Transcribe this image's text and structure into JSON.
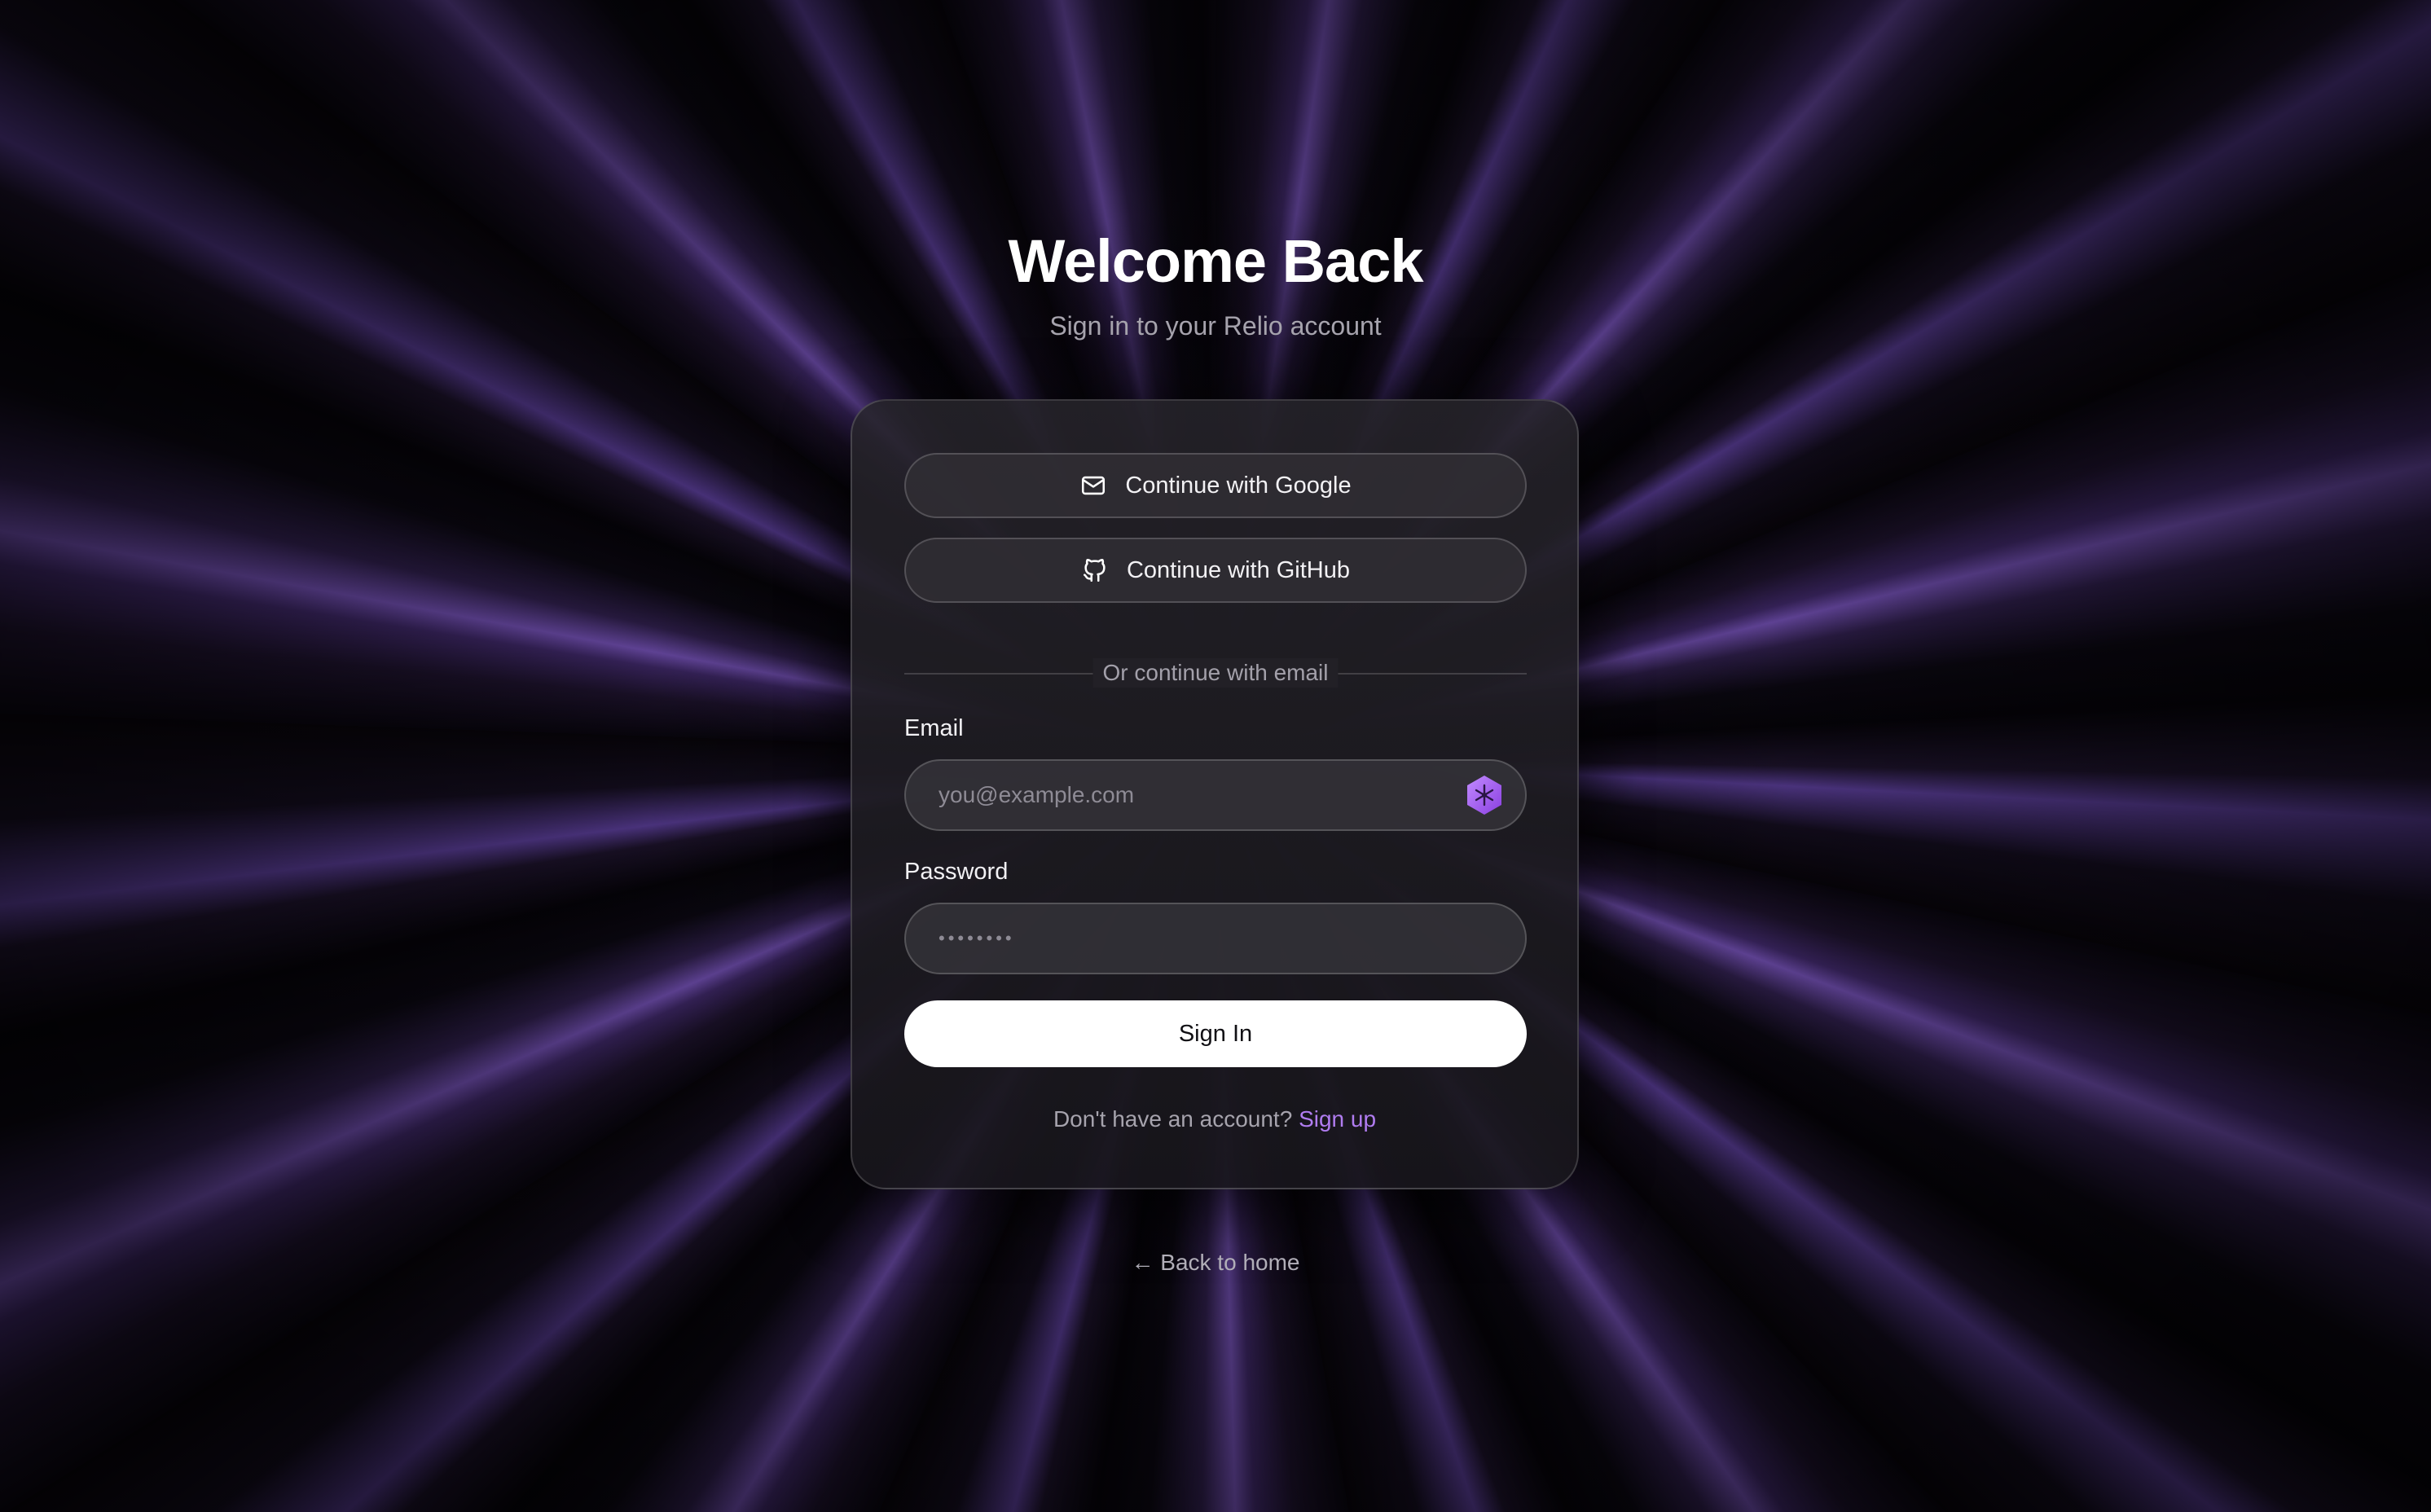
{
  "header": {
    "title": "Welcome Back",
    "subtitle": "Sign in to your Relio account"
  },
  "oauth": {
    "google_label": "Continue with Google",
    "google_icon": "mail-icon",
    "github_label": "Continue with GitHub",
    "github_icon": "github-icon"
  },
  "divider": {
    "text": "Or continue with email"
  },
  "form": {
    "email_label": "Email",
    "email_placeholder": "you@example.com",
    "password_label": "Password",
    "password_value": "••••••••",
    "submit_label": "Sign In"
  },
  "signup": {
    "prompt": "Don't have an account?",
    "link": "Sign up"
  },
  "back": {
    "label": "← Back to home"
  },
  "colors": {
    "accent": "#b07cf0",
    "background": "#050308",
    "card": "#222026"
  }
}
